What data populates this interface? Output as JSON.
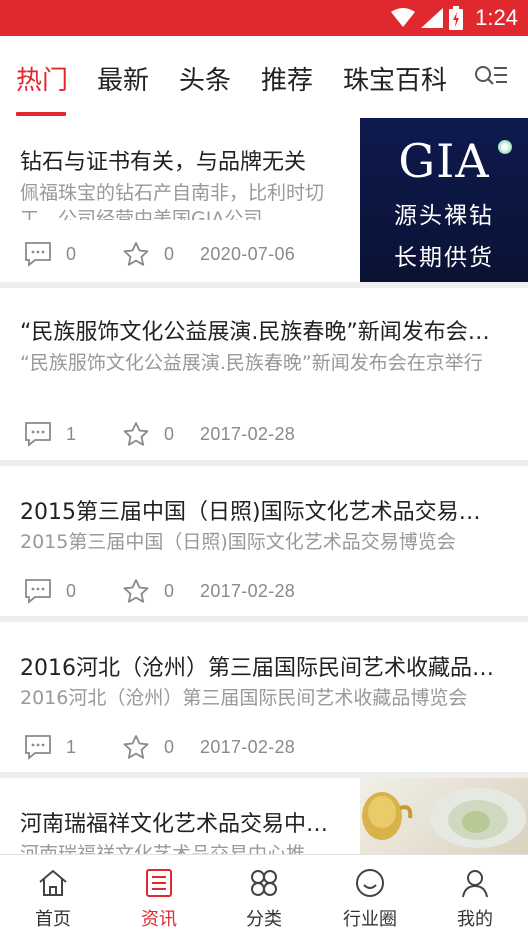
{
  "status_bar": {
    "time": "1:24"
  },
  "tabs": [
    {
      "label": "热门",
      "active": true
    },
    {
      "label": "最新",
      "active": false
    },
    {
      "label": "头条",
      "active": false
    },
    {
      "label": "推荐",
      "active": false
    },
    {
      "label": "珠宝百科",
      "active": false
    }
  ],
  "articles": [
    {
      "title": "钻石与证书有关，与品牌无关",
      "summary": "佩福珠宝的钻石产自南非，比利时切工，公司经营中美国GIA公司",
      "comments": "0",
      "favorites": "0",
      "date": "2020-07-06",
      "thumb": {
        "logo": "GIA",
        "line1": "源头裸钻",
        "line2": "长期供货"
      }
    },
    {
      "title": "“民族服饰文化公益展演.民族春晚”新闻发布会在京举行",
      "summary": "“民族服饰文化公益展演.民族春晚”新闻发布会在京举行",
      "comments": "1",
      "favorites": "0",
      "date": "2017-02-28"
    },
    {
      "title": "2015第三届中国（日照)国际文化艺术品交易博览会",
      "summary": "2015第三届中国（日照)国际文化艺术品交易博览会",
      "comments": "0",
      "favorites": "0",
      "date": "2017-02-28"
    },
    {
      "title": "2016河北（沧州）第三届国际民间艺术收藏品博览会",
      "summary": "2016河北（沧州）第三届国际民间艺术收藏品博览会",
      "comments": "1",
      "favorites": "0",
      "date": "2017-02-28"
    },
    {
      "title": "河南瑞福祥文化艺术品交易中心推",
      "summary": "河南瑞福祥文化艺术品交易中心推"
    }
  ],
  "bottom_nav": [
    {
      "label": "首页",
      "icon": "home-icon",
      "active": false
    },
    {
      "label": "资讯",
      "icon": "news-icon",
      "active": true
    },
    {
      "label": "分类",
      "icon": "category-icon",
      "active": false
    },
    {
      "label": "行业圈",
      "icon": "circle-icon",
      "active": false
    },
    {
      "label": "我的",
      "icon": "profile-icon",
      "active": false
    }
  ],
  "colors": {
    "accent": "#e0282f",
    "muted": "#999999",
    "divider": "#eeeeee"
  }
}
